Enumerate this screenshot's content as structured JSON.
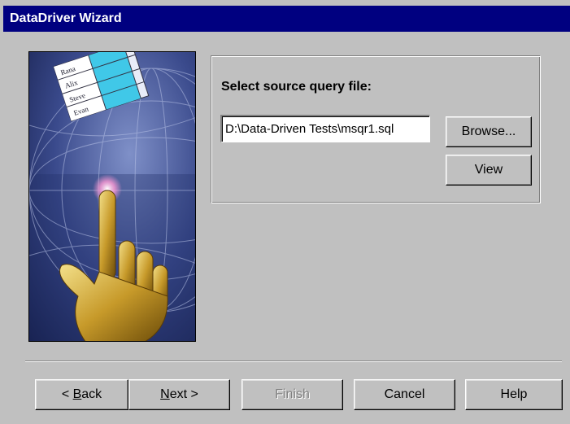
{
  "window": {
    "title": "DataDriver Wizard"
  },
  "query": {
    "prompt": "Select source query file:",
    "file_path": "D:\\Data-Driven Tests\\msqr1.sql",
    "browse_label": "Browse...",
    "view_label": "View"
  },
  "bitmap": {
    "table_names": [
      "Rana",
      "Alix",
      "Steve",
      "Evan"
    ]
  },
  "footer": {
    "back_prefix": "< ",
    "back_hotkey": "B",
    "back_rest": "ack",
    "next_hotkey": "N",
    "next_rest": "ext >",
    "finish_label": "Finish",
    "cancel_label": "Cancel",
    "help_label": "Help"
  },
  "colors": {
    "titlebar": "#000080",
    "dialog": "#c0c0c0",
    "disabled_text": "#808080"
  },
  "icons": {
    "wizard_image": "pointing-hand-over-globe-with-data-table"
  }
}
